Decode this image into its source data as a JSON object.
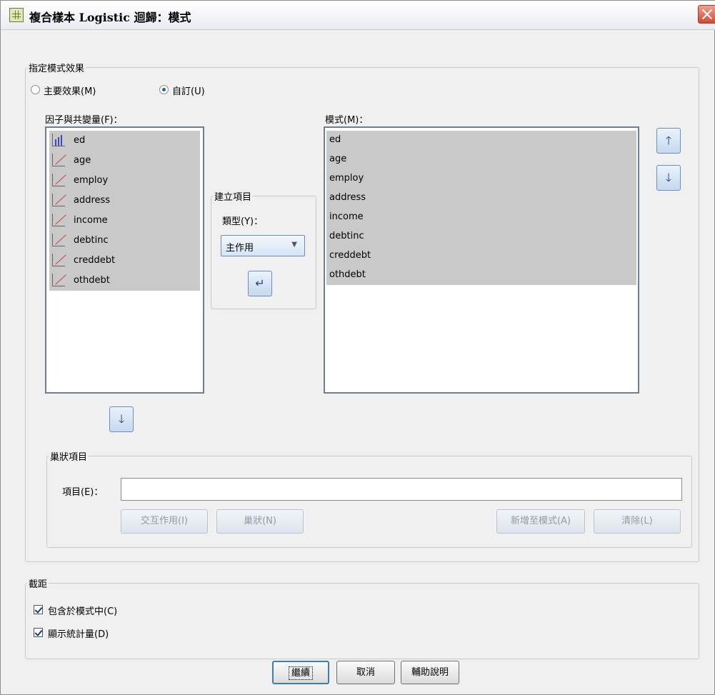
{
  "window": {
    "title": "複合樣本 Logistic 迴歸：模式"
  },
  "model_effects": {
    "legend": "指定模式效果",
    "main_effects": {
      "label": "主要效果(M)",
      "selected": false
    },
    "custom": {
      "label": "自訂(U)",
      "selected": true
    }
  },
  "factors": {
    "label": "因子與共變量(F)：",
    "items": [
      {
        "name": "ed",
        "icon": "ordinal-icon"
      },
      {
        "name": "age",
        "icon": "scale-icon"
      },
      {
        "name": "employ",
        "icon": "scale-icon"
      },
      {
        "name": "address",
        "icon": "scale-icon"
      },
      {
        "name": "income",
        "icon": "scale-icon"
      },
      {
        "name": "debtinc",
        "icon": "scale-icon"
      },
      {
        "name": "creddebt",
        "icon": "scale-icon"
      },
      {
        "name": "othdebt",
        "icon": "scale-icon"
      }
    ]
  },
  "build_terms": {
    "legend": "建立項目",
    "type_label": "類型(Y)：",
    "type_value": "主作用"
  },
  "model": {
    "label": "模式(M)：",
    "items": [
      "ed",
      "age",
      "employ",
      "address",
      "income",
      "debtinc",
      "creddebt",
      "othdebt"
    ]
  },
  "nested": {
    "legend": "巢狀項目",
    "term_label": "項目(E)：",
    "term_value": "",
    "buttons": {
      "interaction": "交互作用(I)",
      "nest": "巢狀(N)",
      "add_to_model": "新增至模式(A)",
      "clear": "清除(L)"
    }
  },
  "intercept": {
    "legend": "截距",
    "include": {
      "label": "包含於模式中(C)",
      "checked": true
    },
    "show_stats": {
      "label": "顯示統計量(D)",
      "checked": true
    }
  },
  "footer": {
    "continue": "繼續",
    "cancel": "取消",
    "help": "輔助說明"
  },
  "colors": {
    "selection": "#c9c9c9",
    "accent": "#3c7fb1"
  }
}
